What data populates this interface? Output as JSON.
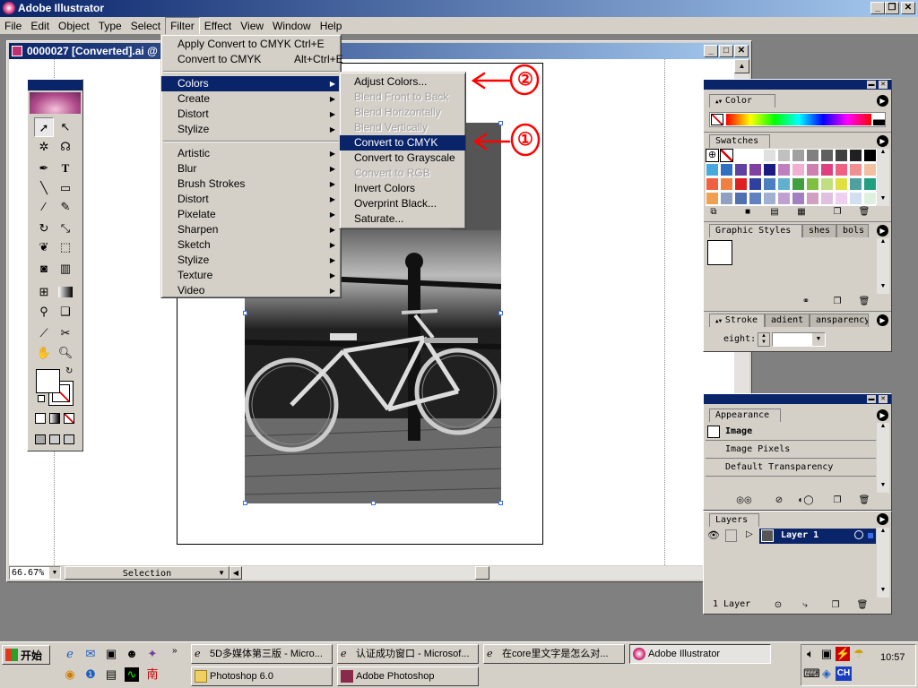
{
  "app": {
    "title": "Adobe Illustrator"
  },
  "menubar": [
    "File",
    "Edit",
    "Object",
    "Type",
    "Select",
    "Filter",
    "Effect",
    "View",
    "Window",
    "Help"
  ],
  "document": {
    "title": "0000027 [Converted].ai @"
  },
  "filter_menu": {
    "apply_last": {
      "label": "Apply Convert to CMYK",
      "shortcut": "Ctrl+E"
    },
    "last_filter": {
      "label": "Convert to CMYK",
      "shortcut": "Alt+Ctrl+E"
    },
    "group1": [
      "Colors",
      "Create",
      "Distort",
      "Stylize"
    ],
    "group2": [
      "Artistic",
      "Blur",
      "Brush Strokes",
      "Distort",
      "Pixelate",
      "Sharpen",
      "Sketch",
      "Stylize",
      "Texture",
      "Video"
    ]
  },
  "colors_submenu": [
    {
      "label": "Adjust Colors...",
      "enabled": true
    },
    {
      "label": "Blend Front to Back",
      "enabled": false
    },
    {
      "label": "Blend Horizontally",
      "enabled": false
    },
    {
      "label": "Blend Vertically",
      "enabled": false
    },
    {
      "label": "Convert to CMYK",
      "enabled": true,
      "highlighted": true
    },
    {
      "label": "Convert to Grayscale",
      "enabled": true
    },
    {
      "label": "Convert to RGB",
      "enabled": false
    },
    {
      "label": "Invert Colors",
      "enabled": true
    },
    {
      "label": "Overprint Black...",
      "enabled": true
    },
    {
      "label": "Saturate...",
      "enabled": true
    }
  ],
  "annotations": {
    "marker1": "①",
    "marker2": "②"
  },
  "palettes": {
    "color": {
      "tab": "Color"
    },
    "swatches": {
      "tab": "Swatches"
    },
    "styles": {
      "tabs": [
        "Graphic Styles",
        "shes",
        "bols"
      ]
    },
    "stroke": {
      "tabs": [
        "Stroke",
        "adient",
        "ansparency"
      ],
      "weight_label": "eight:"
    },
    "appearance": {
      "tab": "Appearance",
      "items": [
        "Image",
        "Image Pixels",
        "Default Transparency"
      ]
    },
    "layers": {
      "tab": "Layers",
      "layer_name": "Layer 1",
      "count": "1 Layer"
    }
  },
  "status": {
    "zoom": "66.67%",
    "mode": "Selection"
  },
  "taskbar": {
    "start": "开始",
    "tasks_row1": [
      "5D多媒体第三版 - Micro...",
      "认证成功窗口 - Microsof...",
      "在core里文字是怎么对...",
      "Adobe Illustrator"
    ],
    "tasks_row2": [
      "Photoshop 6.0",
      "Adobe Photoshop"
    ],
    "clock": "10:57",
    "ime": "CH"
  },
  "colors": {
    "accent": "#0a246a",
    "chrome": "#d4d0c8",
    "annotation": "#ff0000"
  }
}
